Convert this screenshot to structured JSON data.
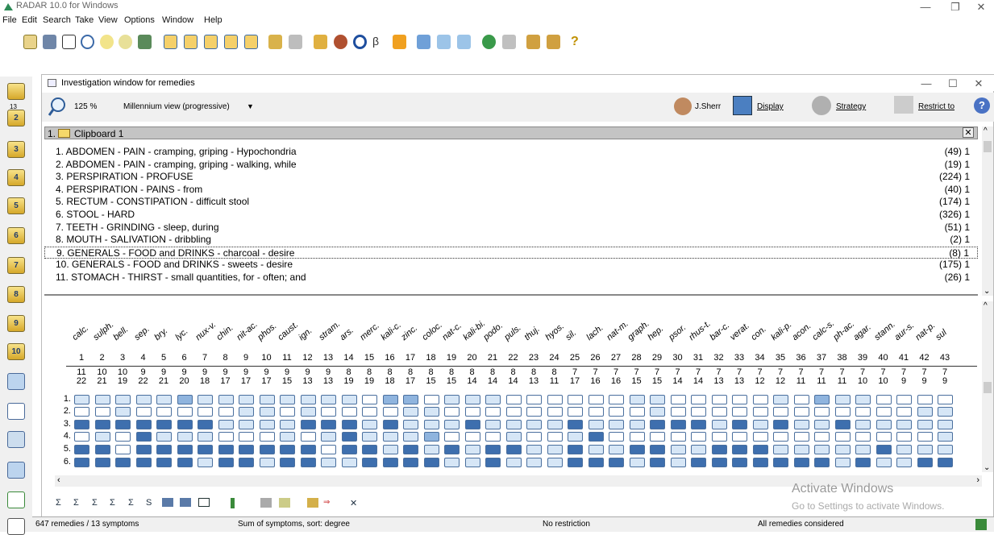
{
  "app": {
    "title": "RADAR 10.0 for Windows",
    "menu": [
      "File",
      "Edit",
      "Search",
      "Take",
      "View",
      "Options",
      "Window",
      "Help"
    ]
  },
  "window": {
    "title": "Investigation window for remedies",
    "zoom": "125 %",
    "view_mode": "Millennium view (progressive)",
    "user": "J.Sherr",
    "display_label": "Display",
    "strategy_label": "Strategy",
    "restrict_label": "Restrict to"
  },
  "clipboard": {
    "header": "1.",
    "name": "Clipboard 1",
    "rubrics": [
      {
        "label": "1. ABDOMEN - PAIN - cramping, griping - Hypochondria",
        "count": "(49) 1"
      },
      {
        "label": "2. ABDOMEN - PAIN - cramping, griping - walking, while",
        "count": "(19) 1"
      },
      {
        "label": "3. PERSPIRATION - PROFUSE",
        "count": "(224) 1"
      },
      {
        "label": "4. PERSPIRATION - PAINS - from",
        "count": "(40) 1"
      },
      {
        "label": "5. RECTUM - CONSTIPATION - difficult stool",
        "count": "(174) 1"
      },
      {
        "label": "6. STOOL - HARD",
        "count": "(326) 1"
      },
      {
        "label": "7. TEETH - GRINDING - sleep, during",
        "count": "(51) 1"
      },
      {
        "label": "8. MOUTH - SALIVATION - dribbling",
        "count": "(2) 1"
      },
      {
        "label": "9. GENERALS - FOOD and DRINKS - charcoal - desire",
        "count": "(8) 1"
      },
      {
        "label": "10. GENERALS - FOOD and DRINKS - sweets - desire",
        "count": "(175) 1"
      },
      {
        "label": "11. STOMACH - THIRST - small quantities, for - often; and",
        "count": "(26) 1"
      }
    ],
    "selected_index": 8
  },
  "remedies": [
    {
      "name": "calc.",
      "n": "1",
      "a": "11",
      "b": "22"
    },
    {
      "name": "sulph.",
      "n": "2",
      "a": "10",
      "b": "21"
    },
    {
      "name": "bell.",
      "n": "3",
      "a": "10",
      "b": "19"
    },
    {
      "name": "sep.",
      "n": "4",
      "a": "9",
      "b": "22"
    },
    {
      "name": "bry.",
      "n": "5",
      "a": "9",
      "b": "21"
    },
    {
      "name": "lyc.",
      "n": "6",
      "a": "9",
      "b": "20"
    },
    {
      "name": "nux-v.",
      "n": "7",
      "a": "9",
      "b": "18"
    },
    {
      "name": "chin.",
      "n": "8",
      "a": "9",
      "b": "17"
    },
    {
      "name": "nit-ac.",
      "n": "9",
      "a": "9",
      "b": "17"
    },
    {
      "name": "phos.",
      "n": "10",
      "a": "9",
      "b": "17"
    },
    {
      "name": "caust.",
      "n": "11",
      "a": "9",
      "b": "15"
    },
    {
      "name": "ign.",
      "n": "12",
      "a": "9",
      "b": "13"
    },
    {
      "name": "stram.",
      "n": "13",
      "a": "9",
      "b": "13"
    },
    {
      "name": "ars.",
      "n": "14",
      "a": "8",
      "b": "19"
    },
    {
      "name": "merc.",
      "n": "15",
      "a": "8",
      "b": "19"
    },
    {
      "name": "kali-c.",
      "n": "16",
      "a": "8",
      "b": "18"
    },
    {
      "name": "zinc.",
      "n": "17",
      "a": "8",
      "b": "17"
    },
    {
      "name": "coloc.",
      "n": "18",
      "a": "8",
      "b": "15"
    },
    {
      "name": "nat-c.",
      "n": "19",
      "a": "8",
      "b": "15"
    },
    {
      "name": "kali-bi.",
      "n": "20",
      "a": "8",
      "b": "14"
    },
    {
      "name": "podo.",
      "n": "21",
      "a": "8",
      "b": "14"
    },
    {
      "name": "puls.",
      "n": "22",
      "a": "8",
      "b": "14"
    },
    {
      "name": "thuj.",
      "n": "23",
      "a": "8",
      "b": "13"
    },
    {
      "name": "hyos.",
      "n": "24",
      "a": "8",
      "b": "11"
    },
    {
      "name": "sil.",
      "n": "25",
      "a": "7",
      "b": "17"
    },
    {
      "name": "lach.",
      "n": "26",
      "a": "7",
      "b": "16"
    },
    {
      "name": "nat-m.",
      "n": "27",
      "a": "7",
      "b": "16"
    },
    {
      "name": "graph.",
      "n": "28",
      "a": "7",
      "b": "15"
    },
    {
      "name": "hep.",
      "n": "29",
      "a": "7",
      "b": "15"
    },
    {
      "name": "psor.",
      "n": "30",
      "a": "7",
      "b": "14"
    },
    {
      "name": "rhus-t.",
      "n": "31",
      "a": "7",
      "b": "14"
    },
    {
      "name": "bar-c.",
      "n": "32",
      "a": "7",
      "b": "13"
    },
    {
      "name": "verat.",
      "n": "33",
      "a": "7",
      "b": "13"
    },
    {
      "name": "con.",
      "n": "34",
      "a": "7",
      "b": "12"
    },
    {
      "name": "kali-p.",
      "n": "35",
      "a": "7",
      "b": "12"
    },
    {
      "name": "acon.",
      "n": "36",
      "a": "7",
      "b": "11"
    },
    {
      "name": "calc-s.",
      "n": "37",
      "a": "7",
      "b": "11"
    },
    {
      "name": "ph-ac.",
      "n": "38",
      "a": "7",
      "b": "11"
    },
    {
      "name": "agar.",
      "n": "39",
      "a": "7",
      "b": "10"
    },
    {
      "name": "stann.",
      "n": "40",
      "a": "7",
      "b": "10"
    },
    {
      "name": "aur-s.",
      "n": "41",
      "a": "7",
      "b": "9"
    },
    {
      "name": "nat-p.",
      "n": "42",
      "a": "7",
      "b": "9"
    },
    {
      "name": "sul",
      "n": "43",
      "a": "7",
      "b": "9"
    }
  ],
  "grid_rows": [
    "1.",
    "2.",
    "3.",
    "4.",
    "5.",
    "6."
  ],
  "grid": [
    [
      1,
      1,
      1,
      1,
      1,
      2,
      1,
      1,
      1,
      1,
      1,
      1,
      1,
      1,
      0,
      2,
      2,
      0,
      1,
      1,
      1,
      0,
      0,
      0,
      0,
      0,
      0,
      1,
      1,
      0,
      0,
      0,
      0,
      0,
      1,
      0,
      2,
      1,
      1,
      0,
      0,
      0,
      0
    ],
    [
      0,
      0,
      1,
      0,
      0,
      0,
      0,
      0,
      1,
      1,
      0,
      1,
      0,
      0,
      0,
      0,
      1,
      1,
      0,
      0,
      0,
      0,
      0,
      0,
      0,
      0,
      0,
      0,
      1,
      0,
      0,
      0,
      0,
      0,
      0,
      0,
      0,
      0,
      0,
      0,
      0,
      1,
      1
    ],
    [
      3,
      3,
      3,
      3,
      3,
      3,
      3,
      1,
      1,
      1,
      1,
      3,
      3,
      3,
      1,
      3,
      1,
      1,
      1,
      3,
      1,
      1,
      1,
      1,
      3,
      1,
      1,
      1,
      3,
      3,
      3,
      1,
      3,
      1,
      3,
      1,
      1,
      3,
      1,
      1,
      1,
      1,
      1
    ],
    [
      0,
      1,
      0,
      3,
      1,
      1,
      1,
      0,
      0,
      0,
      1,
      0,
      1,
      3,
      1,
      1,
      1,
      2,
      0,
      0,
      0,
      1,
      0,
      0,
      1,
      3,
      0,
      0,
      0,
      0,
      0,
      0,
      0,
      0,
      0,
      0,
      0,
      0,
      0,
      0,
      0,
      0,
      1
    ],
    [
      3,
      3,
      0,
      3,
      3,
      3,
      3,
      3,
      3,
      3,
      3,
      3,
      0,
      3,
      3,
      1,
      3,
      1,
      3,
      1,
      3,
      3,
      1,
      1,
      3,
      1,
      1,
      3,
      3,
      1,
      1,
      3,
      3,
      3,
      1,
      1,
      1,
      1,
      1,
      3,
      1,
      1,
      1
    ],
    [
      3,
      3,
      3,
      3,
      3,
      3,
      1,
      3,
      3,
      1,
      3,
      3,
      1,
      1,
      3,
      3,
      3,
      3,
      1,
      1,
      3,
      1,
      1,
      1,
      3,
      3,
      3,
      1,
      3,
      1,
      3,
      3,
      3,
      3,
      3,
      3,
      3,
      1,
      3,
      1,
      1,
      3,
      3
    ]
  ],
  "status": {
    "counts": "647 remedies / 13 symptoms",
    "sort": "Sum of symptoms, sort: degree",
    "restriction": "No restriction",
    "considered": "All remedies considered"
  },
  "watermark": {
    "line1": "Activate Windows",
    "line2": "Go to Settings to activate Windows."
  },
  "left_numbers": [
    "13",
    "2",
    "3",
    "4",
    "5",
    "6",
    "7",
    "8",
    "9",
    "10"
  ]
}
